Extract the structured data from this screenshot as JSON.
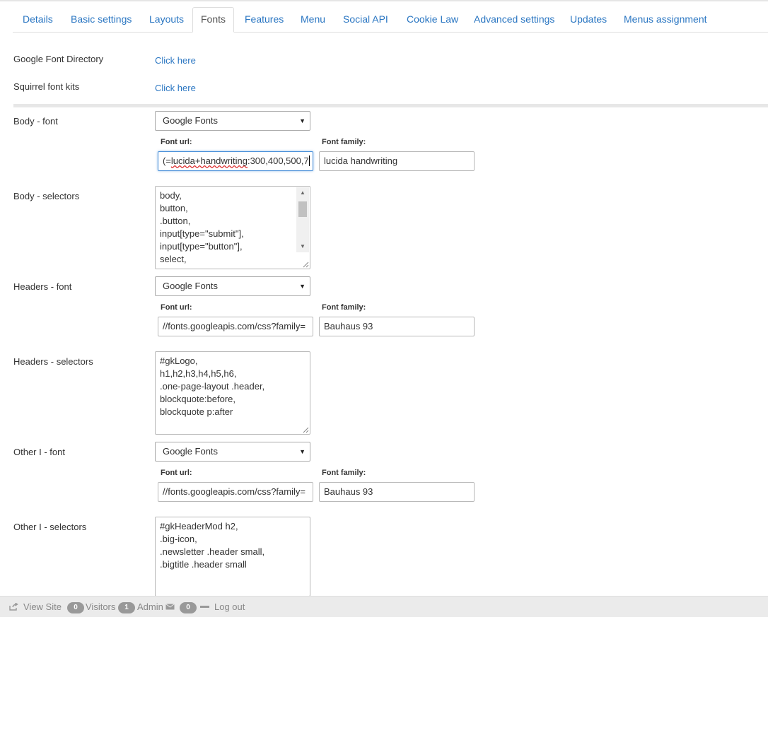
{
  "tabs": [
    {
      "label": "Details"
    },
    {
      "label": "Basic settings"
    },
    {
      "label": "Layouts"
    },
    {
      "label": "Fonts"
    },
    {
      "label": "Features"
    },
    {
      "label": "Menu"
    },
    {
      "label": "Social API"
    },
    {
      "label": "Cookie Law"
    },
    {
      "label": "Advanced settings"
    },
    {
      "label": "Updates"
    },
    {
      "label": "Menus assignment"
    }
  ],
  "active_tab": "Fonts",
  "directories": {
    "google_label": "Google Font Directory",
    "google_link": "Click here",
    "squirrel_label": "Squirrel font kits",
    "squirrel_link": "Click here"
  },
  "sublabels": {
    "font_url": "Font url:",
    "font_family": "Font family:"
  },
  "body": {
    "font_label": "Body - font",
    "font_type": "Google Fonts",
    "font_url_prefix": "(=",
    "font_url_spell": "lucida+handwriting",
    "font_url_suffix": ":300,400,500,7",
    "font_family": "lucida handwriting",
    "selectors_label": "Body - selectors",
    "selectors": [
      "body,",
      "button,",
      ".button,",
      "input[type=\"submit\"],",
      "input[type=\"button\"],",
      "select,"
    ]
  },
  "headers": {
    "font_label": "Headers - font",
    "font_type": "Google Fonts",
    "font_url": "//fonts.googleapis.com/css?family=",
    "font_family": "Bauhaus 93",
    "selectors_label": "Headers - selectors",
    "selectors": [
      "#gkLogo,",
      "h1,h2,h3,h4,h5,h6,",
      ".one-page-layout .header,",
      "blockquote:before,",
      "blockquote p:after"
    ]
  },
  "other1": {
    "font_label": "Other I - font",
    "font_type": "Google Fonts",
    "font_url": "//fonts.googleapis.com/css?family=",
    "font_family": "Bauhaus 93",
    "selectors_label": "Other I - selectors",
    "selectors": [
      "#gkHeaderMod h2,",
      ".big-icon,",
      ".newsletter .header small,",
      ".bigtitle .header small"
    ]
  },
  "footer": {
    "view_site": "View Site",
    "visitors_count": "0",
    "visitors_label": "Visitors",
    "admin_count": "1",
    "admin_label": "Admin",
    "messages_count": "0",
    "logout": "Log out"
  },
  "colors": {
    "link": "#2a76c2",
    "focus": "#4a90d9",
    "badge": "#999999"
  }
}
